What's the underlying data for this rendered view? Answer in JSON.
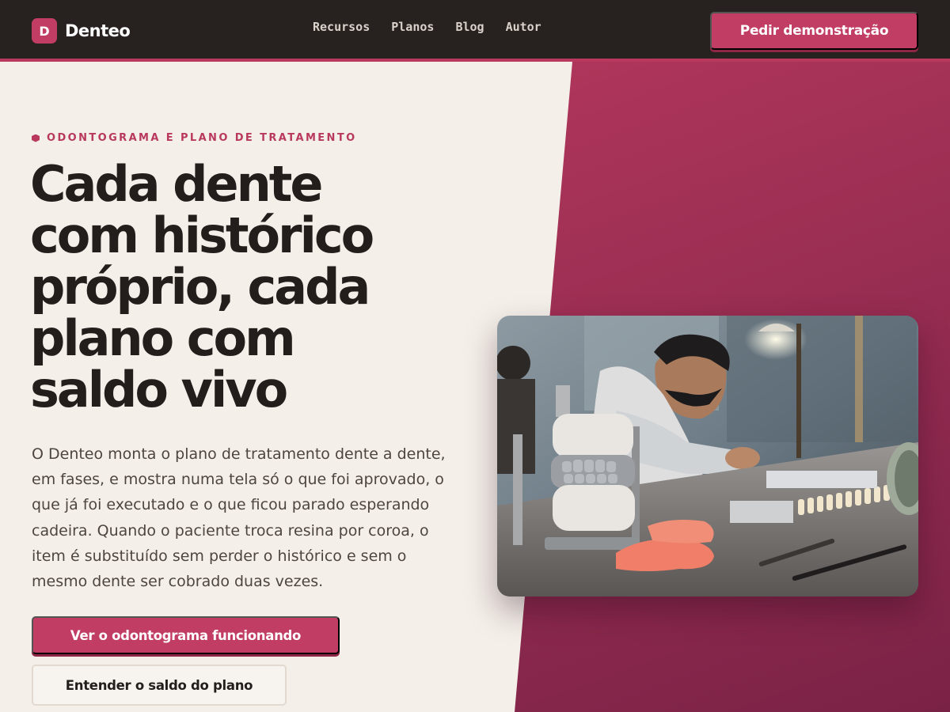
{
  "brand": {
    "mark": "D",
    "name": "Denteo"
  },
  "nav": {
    "links": [
      "Recursos",
      "Planos",
      "Blog",
      "Autor"
    ],
    "cta": "Pedir demonstração"
  },
  "hero": {
    "eyebrow": "ODONTOGRAMA E PLANO DE TRATAMENTO",
    "headline_lines": [
      "Cada dente",
      "com histórico",
      "próprio, cada",
      "plano com",
      "saldo vivo"
    ],
    "lead": "O Denteo monta o plano de tratamento dente a dente, em fases, e mostra numa tela só o que foi aprovado, o que já foi executado e o que ficou parado esperando cadeira. Quando o paciente troca resina por coroa, o item é substituído sem perder o histórico e sem o mesmo dente ser cobrado duas vezes.",
    "primary_cta": "Ver o odontograma funcionando",
    "secondary_cta": "Entender o saldo do plano"
  },
  "colors": {
    "accent": "#c13d63",
    "nav_background": "#27211f",
    "page_background": "#f4efe9",
    "headline": "#231e1c"
  },
  "icons": {
    "eyebrow": "hexagon-bullet-icon",
    "brand": "brand-logo-icon"
  }
}
